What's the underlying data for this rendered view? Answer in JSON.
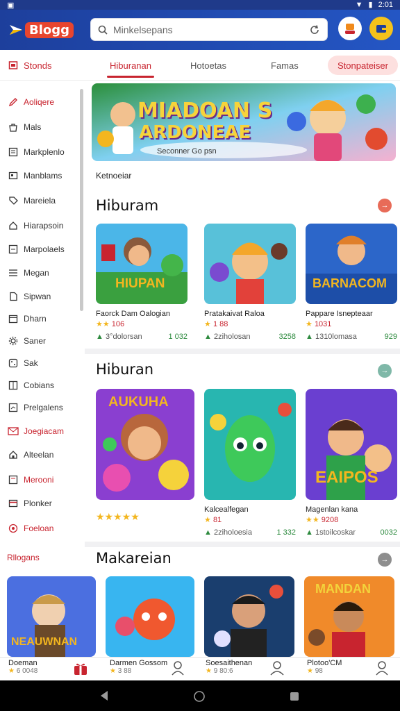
{
  "status": {
    "time": "2:01"
  },
  "app": {
    "logo_text": "Blogg",
    "brand_color": "#1d3f9c",
    "accent": "#c8242f"
  },
  "search": {
    "placeholder": "Minkelsepans"
  },
  "tabs": [
    {
      "label": "Stonds"
    },
    {
      "label": "Hiburanan"
    },
    {
      "label": "Hotoetas"
    },
    {
      "label": "Famas"
    },
    {
      "label": "Stonpateiser"
    }
  ],
  "sidebar": {
    "items": [
      {
        "label": "Aoliqere",
        "icon": "pencil-icon"
      },
      {
        "label": "Mals",
        "icon": "bag-icon"
      },
      {
        "label": "Markplenlo",
        "icon": "list-icon"
      },
      {
        "label": "Manblams",
        "icon": "box-icon"
      },
      {
        "label": "Mareiela",
        "icon": "tag-icon"
      },
      {
        "label": "Hiarapsoin",
        "icon": "home-icon"
      },
      {
        "label": "Marpolaels",
        "icon": "square-icon"
      },
      {
        "label": "Megan",
        "icon": "lines-icon"
      },
      {
        "label": "Sipwan",
        "icon": "doc-icon"
      },
      {
        "label": "Dharn",
        "icon": "calendar-icon"
      },
      {
        "label": "Saner",
        "icon": "gear-icon"
      },
      {
        "label": "Sak",
        "icon": "dice-icon"
      },
      {
        "label": "Cobians",
        "icon": "grid-icon"
      },
      {
        "label": "Prelgalens",
        "icon": "chart-icon"
      },
      {
        "label": "Joegiacam",
        "icon": "mail-icon"
      },
      {
        "label": "Alteelan",
        "icon": "house-icon"
      },
      {
        "label": "Merooni",
        "icon": "note-icon"
      },
      {
        "label": "Plonker",
        "icon": "card-icon"
      },
      {
        "label": "Foeloan",
        "icon": "target-icon"
      }
    ],
    "footer_label": "Rllogans"
  },
  "banner": {
    "title_line1": "MIADOAN S",
    "title_line2": "ARDONEAE",
    "subtitle": "Seconner Go psn"
  },
  "section0": {
    "label": "Ketnoeiar"
  },
  "section1": {
    "title": "Hiburam",
    "cards": [
      {
        "art_text": "HIUPAN",
        "name": "Faorck Dam Oalogian",
        "rating_value": "106",
        "meta_left": "3°dolorsan",
        "meta_right": "1 032"
      },
      {
        "art_text": "",
        "name": "Pratakaivat Raloa",
        "rating_value": "1 88",
        "meta_left": "2ziholosan",
        "meta_right": "3258"
      },
      {
        "art_text": "BARNACOM",
        "name": "Pappare Isnepteaar",
        "rating_value": "1031",
        "meta_left": "1310lomasa",
        "meta_right": "929"
      }
    ]
  },
  "section2": {
    "title": "Hiburan",
    "cards": [
      {
        "art_text": "AUKUHA",
        "name": "",
        "rating_value": "",
        "meta_left": "",
        "meta_right": ""
      },
      {
        "art_text": "",
        "name": "Kalcealfegan",
        "rating_value": "81",
        "meta_left": "2ziholoesia",
        "meta_right": "1 332"
      },
      {
        "art_text": "EAIPOS",
        "name": "Magenlan kana",
        "rating_value": "9208",
        "meta_left": "1stoilcoskar",
        "meta_right": "0032"
      }
    ]
  },
  "section3": {
    "title": "Makareian",
    "cards": [
      {
        "art_text": "NEAUWNAN",
        "name": "Doeman",
        "rating_value": "6 0048"
      },
      {
        "art_text": "",
        "name": "Darmen Gossom",
        "rating_value": "3 88"
      },
      {
        "art_text": "",
        "name": "Soesaithenan",
        "rating_value": "9 80:6"
      },
      {
        "art_text": "MANDAN",
        "name": "Plotoo'CM",
        "rating_value": "98"
      }
    ]
  }
}
